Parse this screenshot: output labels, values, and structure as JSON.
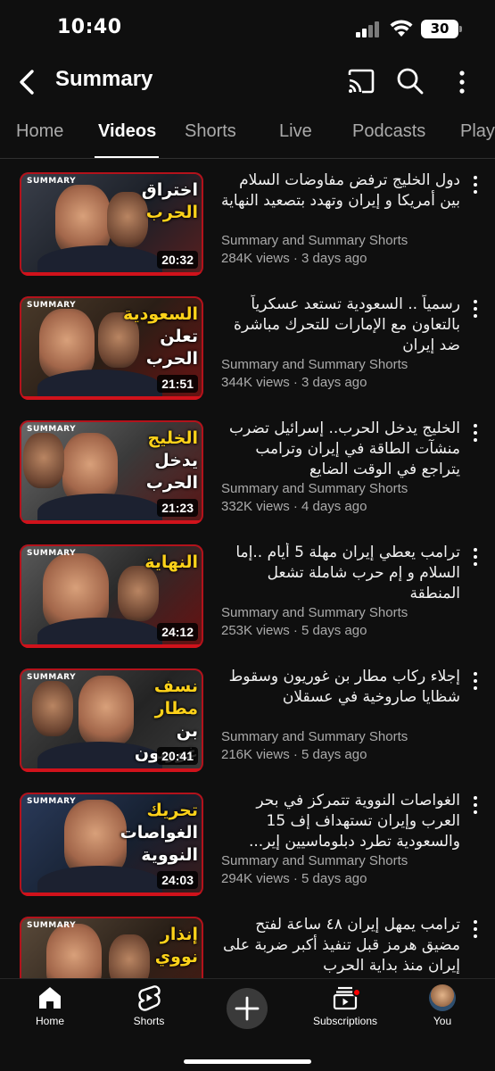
{
  "status": {
    "time": "10:40",
    "battery": "30"
  },
  "header": {
    "title": "Summary"
  },
  "tabs": [
    {
      "label": "Home"
    },
    {
      "label": "Videos"
    },
    {
      "label": "Shorts"
    },
    {
      "label": "Live"
    },
    {
      "label": "Podcasts"
    },
    {
      "label": "Play"
    }
  ],
  "active_tab": "Videos",
  "thumb_brand": "SUMMARY",
  "videos": [
    {
      "title": "دول الخليج ترفض مفاوضات السلام بين أمريكا و إيران وتهدد بتصعيد النهاية",
      "channel": "Summary and Summary Shorts",
      "meta": "284K views · 3 days ago",
      "duration": "20:32",
      "caption_1": "اختراق",
      "caption_2": "الحرب"
    },
    {
      "title": "رسمياً .. السعودية تستعد عسكرياً بالتعاون مع الإمارات للتحرك مباشرة ضد إيران",
      "channel": "Summary and Summary Shorts",
      "meta": "344K views · 3 days ago",
      "duration": "21:51",
      "caption_1": "السعودية",
      "caption_2": "تعلن الحرب"
    },
    {
      "title": "الخليج يدخل الحرب.. إسرائيل تضرب منشآت الطاقة في إيران وترامب يتراجع في الوقت الضايع",
      "channel": "Summary and Summary Shorts",
      "meta": "332K views · 4 days ago",
      "duration": "21:23",
      "caption_1": "الخليج",
      "caption_2": "يدخل الحرب"
    },
    {
      "title": "ترامب يعطي إيران مهلة 5 أيام ..إما السلام و إم حرب شاملة تشعل المنطقة",
      "channel": "Summary and Summary Shorts",
      "meta": "253K views · 5 days ago",
      "duration": "24:12",
      "caption_1": "النهاية",
      "caption_2": ""
    },
    {
      "title": "إجلاء ركاب مطار بن غوريون وسقوط شظايا صاروخية في عسقلان",
      "channel": "Summary and Summary Shorts",
      "meta": "216K views · 5 days ago",
      "duration": "20:41",
      "caption_1": "نسف مطار",
      "caption_2": "بن غوريون"
    },
    {
      "title": "الغواصات النووية تتمركز في بحر العرب وإيران تستهداف إف 15 والسعودية تطرد دبلوماسيين إير...",
      "channel": "Summary and Summary Shorts",
      "meta": "294K views · 5 days ago",
      "duration": "24:03",
      "caption_1": "تحريك",
      "caption_2": "الغواصات النووية"
    },
    {
      "title": "ترامب يمهل إيران ٤٨ ساعة لفتح مضيق هرمز قبل تنفيذ أكبر ضربة على إيران منذ بداية الحرب",
      "channel": "",
      "meta": "",
      "duration": "",
      "caption_1": "إنذار",
      "caption_2": "نووي"
    }
  ],
  "bottom_nav": {
    "home": "Home",
    "shorts": "Shorts",
    "subscriptions": "Subscriptions",
    "you": "You"
  },
  "colors": {
    "background": "#0f0f0f",
    "accent_red": "#ff0000",
    "secondary_text": "#aaaaaa"
  }
}
